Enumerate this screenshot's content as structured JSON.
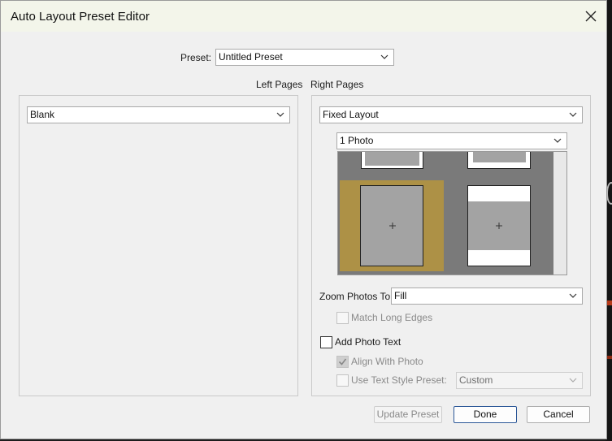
{
  "window": {
    "title": "Auto Layout Preset Editor"
  },
  "preset": {
    "label": "Preset:",
    "value": "Untitled Preset"
  },
  "left_pages": {
    "heading": "Left Pages",
    "layout_value": "Blank"
  },
  "right_pages": {
    "heading": "Right Pages",
    "layout_value": "Fixed Layout",
    "template_value": "1 Photo",
    "zoom_label": "Zoom Photos To:",
    "zoom_value": "Fill",
    "match_long_edges": {
      "label": "Match Long Edges",
      "checked": false,
      "enabled": false
    },
    "add_photo_text": {
      "label": "Add Photo Text",
      "checked": false,
      "enabled": true
    },
    "align_with_photo": {
      "label": "Align With Photo",
      "checked": true,
      "enabled": false
    },
    "use_text_style": {
      "label": "Use Text Style Preset:",
      "checked": false,
      "enabled": false,
      "value": "Custom"
    }
  },
  "buttons": {
    "update": "Update Preset",
    "done": "Done",
    "cancel": "Cancel"
  },
  "colors": {
    "selected_layout": "#ad9146",
    "preview_bg": "#7a7a7a",
    "cell": "#a3a3a3"
  },
  "icons": {
    "close": "close-icon",
    "chevron": "chevron-down-icon",
    "check": "check-icon",
    "plus": "plus-icon"
  }
}
